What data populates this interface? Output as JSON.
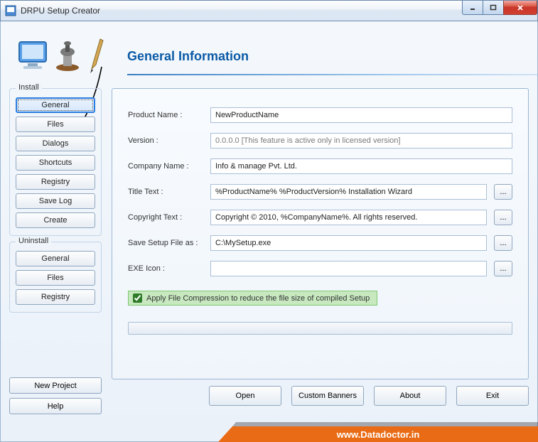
{
  "window": {
    "title": "DRPU Setup Creator"
  },
  "header": {
    "section_title": "General Information"
  },
  "sidebar": {
    "install_group": "Install",
    "uninstall_group": "Uninstall",
    "install_items": [
      "General",
      "Files",
      "Dialogs",
      "Shortcuts",
      "Registry",
      "Save Log",
      "Create"
    ],
    "uninstall_items": [
      "General",
      "Files",
      "Registry"
    ]
  },
  "form": {
    "product_name_label": "Product Name :",
    "product_name_value": "NewProductName",
    "version_label": "Version :",
    "version_value": "0.0.0.0 [This feature is active only in licensed version]",
    "company_label": "Company Name :",
    "company_value": "Info & manage Pvt. Ltd.",
    "title_text_label": "Title Text :",
    "title_text_value": "%ProductName% %ProductVersion% Installation Wizard",
    "copyright_label": "Copyright Text :",
    "copyright_value": "Copyright © 2010, %CompanyName%. All rights reserved.",
    "save_setup_label": "Save Setup File as :",
    "save_setup_value": "C:\\MySetup.exe",
    "exe_icon_label": "EXE Icon :",
    "exe_icon_value": "",
    "browse_label": "...",
    "compression_label": "Apply File Compression to reduce the file size of compiled Setup"
  },
  "bottom": {
    "new_project": "New Project",
    "help": "Help",
    "open": "Open",
    "custom_banners": "Custom Banners",
    "about": "About",
    "exit": "Exit"
  },
  "footer": {
    "url": "www.Datadoctor.in"
  }
}
